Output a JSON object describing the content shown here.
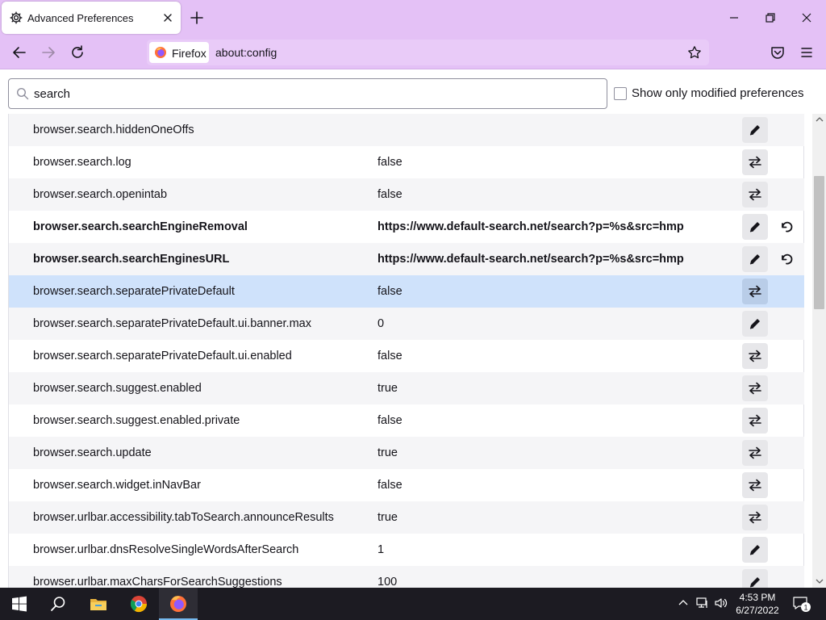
{
  "browser": {
    "tab_title": "Advanced Preferences",
    "identity_label": "Firefox",
    "url": "about:config",
    "accent_color": "#e4c1f6"
  },
  "toolbar": {
    "search_value": "search",
    "modified_only_label": "Show only modified preferences"
  },
  "preferences": [
    {
      "name": "browser.search.hiddenOneOffs",
      "value": "",
      "action": "edit",
      "modified": false
    },
    {
      "name": "browser.search.log",
      "value": "false",
      "action": "toggle",
      "modified": false
    },
    {
      "name": "browser.search.openintab",
      "value": "false",
      "action": "toggle",
      "modified": false
    },
    {
      "name": "browser.search.searchEngineRemoval",
      "value": "https://www.default-search.net/search?p=%s&src=hmp",
      "action": "edit",
      "modified": true
    },
    {
      "name": "browser.search.searchEnginesURL",
      "value": "https://www.default-search.net/search?p=%s&src=hmp",
      "action": "edit",
      "modified": true
    },
    {
      "name": "browser.search.separatePrivateDefault",
      "value": "false",
      "action": "toggle",
      "modified": false,
      "selected": true
    },
    {
      "name": "browser.search.separatePrivateDefault.ui.banner.max",
      "value": "0",
      "action": "edit",
      "modified": false
    },
    {
      "name": "browser.search.separatePrivateDefault.ui.enabled",
      "value": "false",
      "action": "toggle",
      "modified": false
    },
    {
      "name": "browser.search.suggest.enabled",
      "value": "true",
      "action": "toggle",
      "modified": false
    },
    {
      "name": "browser.search.suggest.enabled.private",
      "value": "false",
      "action": "toggle",
      "modified": false
    },
    {
      "name": "browser.search.update",
      "value": "true",
      "action": "toggle",
      "modified": false
    },
    {
      "name": "browser.search.widget.inNavBar",
      "value": "false",
      "action": "toggle",
      "modified": false
    },
    {
      "name": "browser.urlbar.accessibility.tabToSearch.announceResults",
      "value": "true",
      "action": "toggle",
      "modified": false
    },
    {
      "name": "browser.urlbar.dnsResolveSingleWordsAfterSearch",
      "value": "1",
      "action": "edit",
      "modified": false
    },
    {
      "name": "browser.urlbar.maxCharsForSearchSuggestions",
      "value": "100",
      "action": "edit",
      "modified": false
    }
  ],
  "taskbar": {
    "time": "4:53 PM",
    "date": "6/27/2022",
    "notification_count": "1"
  }
}
